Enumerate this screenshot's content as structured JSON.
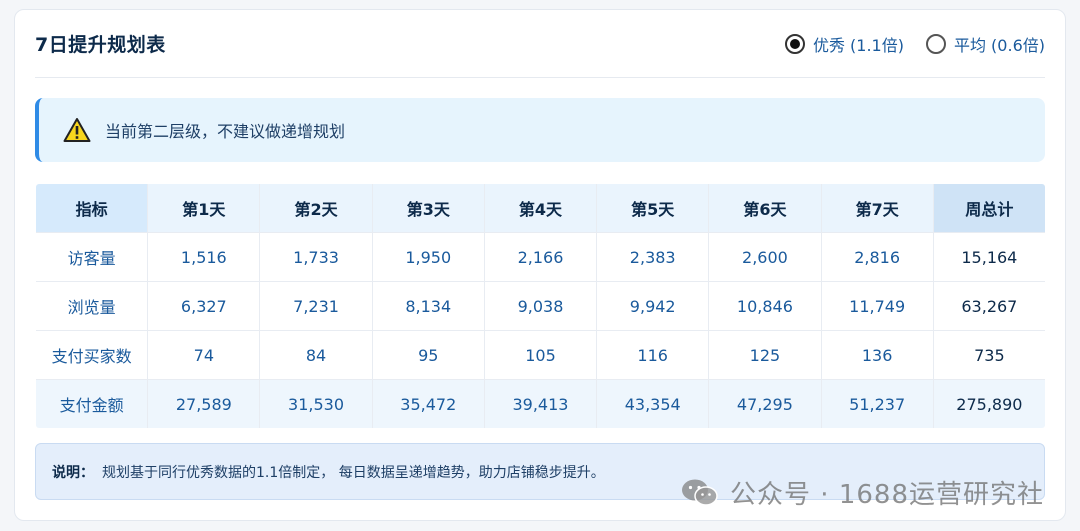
{
  "header": {
    "title": "7日提升规划表",
    "options": [
      {
        "label": "优秀 (1.1倍)",
        "checked": true
      },
      {
        "label": "平均 (0.6倍)",
        "checked": false
      }
    ]
  },
  "warning": {
    "icon": "warning-icon",
    "text": "当前第二层级，不建议做递增规划"
  },
  "table": {
    "columns": [
      "指标",
      "第1天",
      "第2天",
      "第3天",
      "第4天",
      "第5天",
      "第6天",
      "第7天",
      "周总计"
    ],
    "rows": [
      {
        "label": "访客量",
        "values": [
          "1,516",
          "1,733",
          "1,950",
          "2,166",
          "2,383",
          "2,600",
          "2,816"
        ],
        "total": "15,164"
      },
      {
        "label": "浏览量",
        "values": [
          "6,327",
          "7,231",
          "8,134",
          "9,038",
          "9,942",
          "10,846",
          "11,749"
        ],
        "total": "63,267"
      },
      {
        "label": "支付买家数",
        "values": [
          "74",
          "84",
          "95",
          "105",
          "116",
          "125",
          "136"
        ],
        "total": "735"
      },
      {
        "label": "支付金额",
        "values": [
          "27,589",
          "31,530",
          "35,472",
          "39,413",
          "43,354",
          "47,295",
          "51,237"
        ],
        "total": "275,890"
      }
    ]
  },
  "note": {
    "label": "说明：",
    "text": "规划基于同行优秀数据的1.1倍制定， 每日数据呈递增趋势，助力店铺稳步提升。"
  },
  "watermark": {
    "icon": "wechat-icon",
    "text": "公众号 · 1688运营研究社"
  },
  "colors": {
    "accent": "#2f8be6",
    "header_bg": "#eaf4fd",
    "text_blue": "#1a5a9c"
  }
}
